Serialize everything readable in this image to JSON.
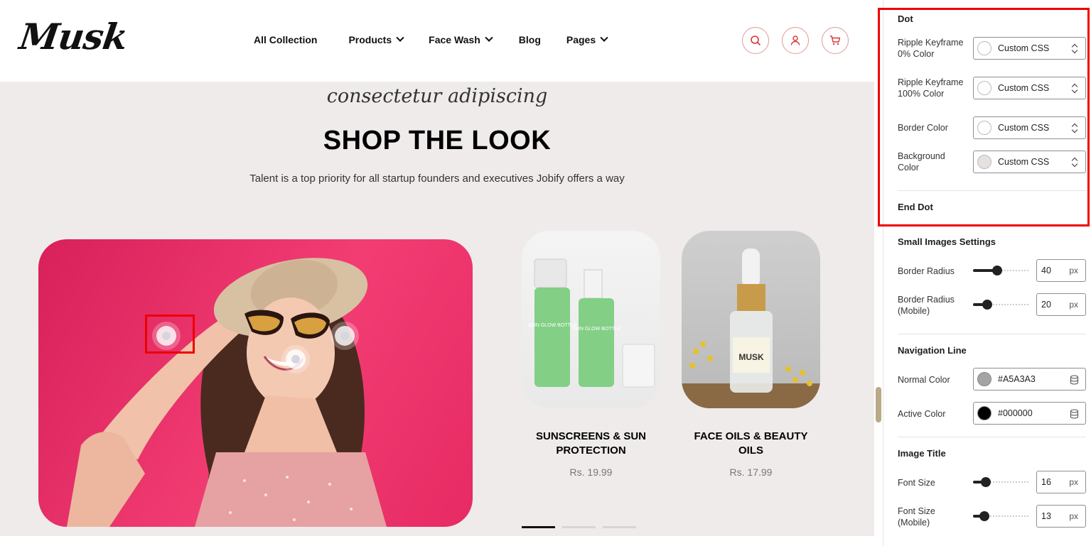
{
  "header": {
    "logo": "Musk",
    "nav": [
      {
        "label": "All Collection",
        "dropdown": false
      },
      {
        "label": "Products",
        "dropdown": true
      },
      {
        "label": "Face Wash",
        "dropdown": true
      },
      {
        "label": "Blog",
        "dropdown": false
      },
      {
        "label": "Pages",
        "dropdown": true
      }
    ],
    "icons": [
      "search-icon",
      "user-icon",
      "cart-icon"
    ],
    "accent_color": "#e06b6b"
  },
  "hero": {
    "script_text": "consectetur adipiscing",
    "title": "SHOP THE LOOK",
    "subtitle": "Talent is a top priority for all startup founders and executives Jobify offers a way"
  },
  "products": [
    {
      "title": "SUNSCREENS & SUN PROTECTION",
      "price": "Rs. 19.99"
    },
    {
      "title": "FACE OILS & BEAUTY OILS",
      "price": "Rs. 17.99"
    }
  ],
  "product_label": {
    "bottle_text": "SKIN GLOW BOTTLE",
    "serum_brand": "MUSK"
  },
  "pager": {
    "count": 3,
    "active": 0
  },
  "panel": {
    "dot": {
      "title": "Dot",
      "rows": [
        {
          "label": "Ripple Keyframe 0% Color",
          "value": "Custom CSS",
          "swatch": "#ffffff"
        },
        {
          "label": "Ripple Keyframe 100% Color",
          "value": "Custom CSS",
          "swatch": "#ffffff"
        },
        {
          "label": "Border Color",
          "value": "Custom CSS",
          "swatch": "#ffffff"
        },
        {
          "label": "Background Color",
          "value": "Custom CSS",
          "swatch": "#e6e1e1"
        }
      ],
      "end_label": "End Dot"
    },
    "small_images": {
      "title": "Small Images Settings",
      "rows": [
        {
          "label": "Border Radius",
          "value": "40",
          "unit": "px",
          "fraction": 0.43
        },
        {
          "label": "Border Radius (Mobile)",
          "value": "20",
          "unit": "px",
          "fraction": 0.26
        }
      ]
    },
    "navigation_line": {
      "title": "Navigation Line",
      "rows": [
        {
          "label": "Normal Color",
          "value": "#A5A3A3",
          "swatch": "#a5a3a3"
        },
        {
          "label": "Active Color",
          "value": "#000000",
          "swatch": "#000000"
        }
      ]
    },
    "image_title": {
      "title": "Image Title",
      "rows": [
        {
          "label": "Font Size",
          "value": "16",
          "unit": "px",
          "fraction": 0.22
        },
        {
          "label": "Font Size (Mobile)",
          "value": "13",
          "unit": "px",
          "fraction": 0.2
        }
      ]
    }
  }
}
